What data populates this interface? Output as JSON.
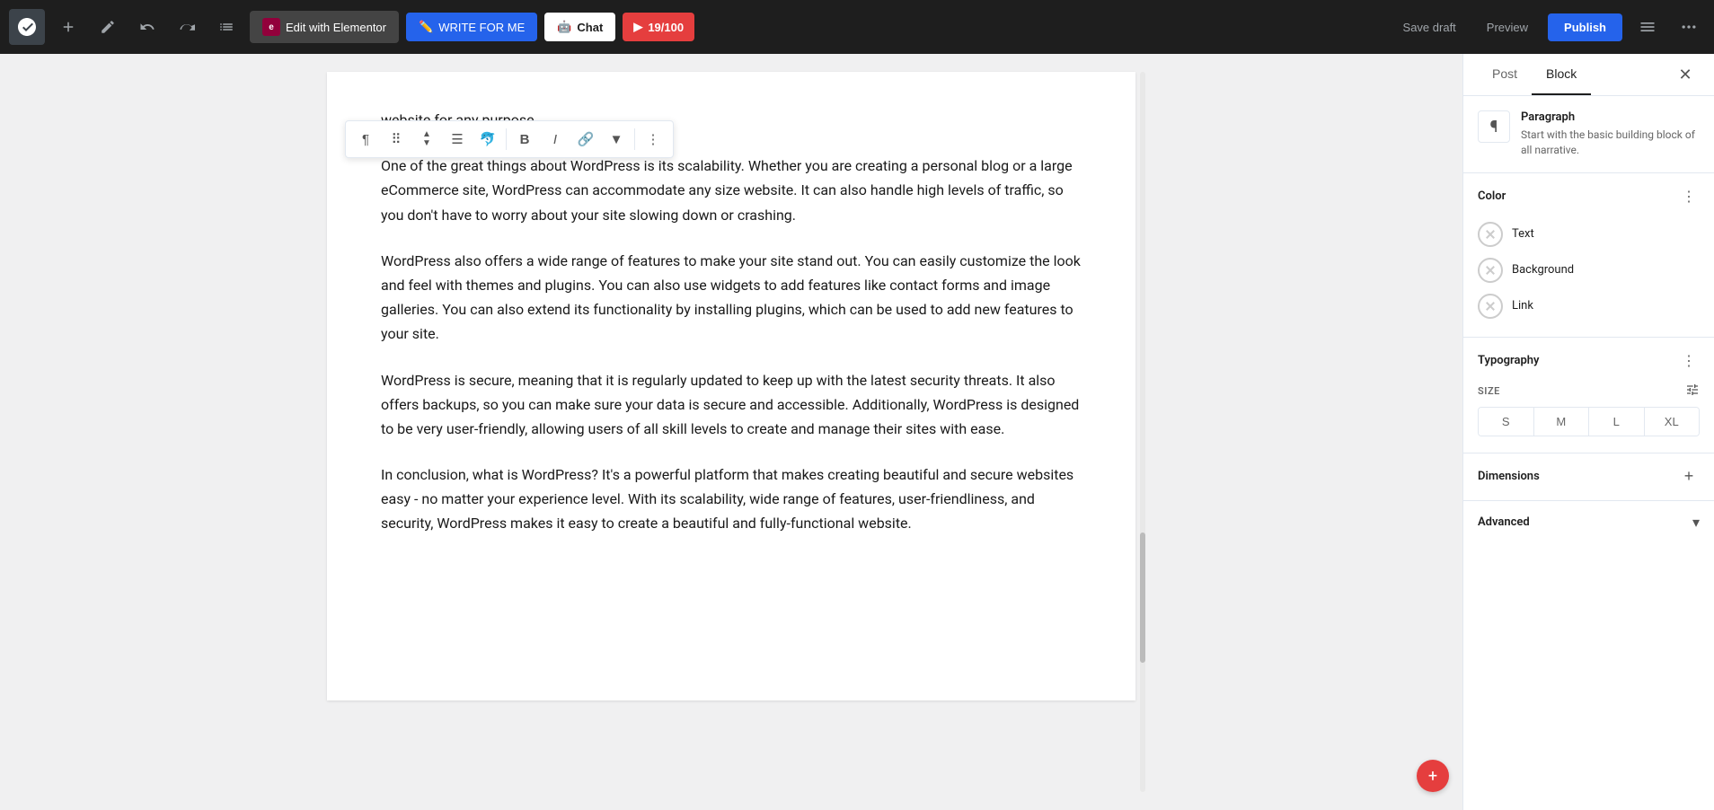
{
  "topbar": {
    "add_label": "+",
    "edit_elementor_label": "Edit with Elementor",
    "write_for_me_label": "WRITE FOR ME",
    "chat_label": "Chat",
    "word_count_label": "19/100",
    "save_draft_label": "Save draft",
    "preview_label": "Preview",
    "publish_label": "Publish"
  },
  "editor": {
    "partial_top_text": "website for any purpose.",
    "paragraph1": "One of the great things about WordPress is its scalability. Whether you are creating a personal blog or a large eCommerce site, WordPress can accommodate any size website. It can also handle high levels of traffic, so you don't have to worry about your site slowing down or crashing.",
    "paragraph2": " WordPress also offers a wide range of features to make your site stand out. You can easily customize the look and feel with themes and plugins. You can also use widgets to add features like contact forms and image galleries. You can also extend its functionality by installing plugins, which can be used to add new features to your site.",
    "paragraph3": " WordPress is secure, meaning that it is regularly updated to keep up with the latest security threats. It also offers backups, so you can make sure your data is secure and accessible. Additionally, WordPress is designed to be very user-friendly, allowing users of all skill levels to create and manage their sites with ease.",
    "paragraph4": " In conclusion, what is WordPress? It's a powerful platform that makes creating beautiful and secure websites easy - no matter your experience level. With its scalability, wide range of features, user-friendliness, and security, WordPress makes it easy to create a beautiful and fully-functional website."
  },
  "sidebar": {
    "tab_post_label": "Post",
    "tab_block_label": "Block",
    "block_name": "Paragraph",
    "block_description": "Start with the basic building block of all narrative.",
    "color_section_title": "Color",
    "text_label": "Text",
    "background_label": "Background",
    "link_label": "Link",
    "typography_section_title": "Typography",
    "size_label": "SIZE",
    "size_s": "S",
    "size_m": "M",
    "size_l": "L",
    "size_xl": "XL",
    "dimensions_label": "Dimensions",
    "advanced_label": "Advanced"
  }
}
